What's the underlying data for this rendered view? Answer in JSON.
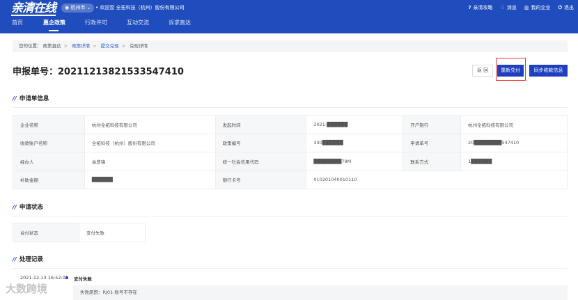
{
  "header": {
    "logo": "亲清在线",
    "city": "杭州市",
    "welcome": "• 欢迎您 全拓科技（杭州）股份有限公司",
    "links": [
      {
        "icon": "help-icon",
        "glyph": "?",
        "label": "亲清攻略"
      },
      {
        "icon": "bell-icon",
        "glyph": "♢",
        "label": "消息"
      },
      {
        "icon": "building-icon",
        "glyph": "▥",
        "label": "我的企业"
      },
      {
        "icon": "power-icon",
        "glyph": "⏻",
        "label": "退出"
      }
    ]
  },
  "nav": [
    "首页",
    "惠企政策",
    "行政许可",
    "互动交流",
    "诉求直达"
  ],
  "breadcrumb": {
    "prefix": "您的位置：",
    "items": [
      "政策直达",
      "政策详情",
      "提交兑现",
      "兑现详情"
    ]
  },
  "title": "申报单号：20211213821533547410",
  "buttons": {
    "back": "返 回",
    "repay": "重新兑付",
    "sync": "同步收款信息"
  },
  "sections": {
    "info": "申请单信息",
    "status": "申请状态",
    "records": "处理记录"
  },
  "info_rows": [
    [
      "企业名称",
      "杭州全拓科技有限公司",
      "发起时间",
      "2021-██████",
      "开户银行",
      "杭州全拓科技有限公司"
    ],
    [
      "收款账户名称",
      "全拓科技（杭州）股份有限公司",
      "政策编号",
      "330██████",
      "申请单号",
      "20████████547410"
    ],
    [
      "经办人",
      "余彦锋",
      "统一社会信用代码",
      "████████79M",
      "联系方式",
      "1██████"
    ],
    [
      "补助金额",
      "██████",
      "银行卡号",
      "010201040010110"
    ]
  ],
  "status": {
    "label": "兑付状态",
    "value": "支付失败"
  },
  "record": {
    "time": "2021-12-13 16:52:01",
    "title": "支付失败",
    "reason": "失败原因：RJ01-账号不存在"
  },
  "watermark": "大数跨境"
}
